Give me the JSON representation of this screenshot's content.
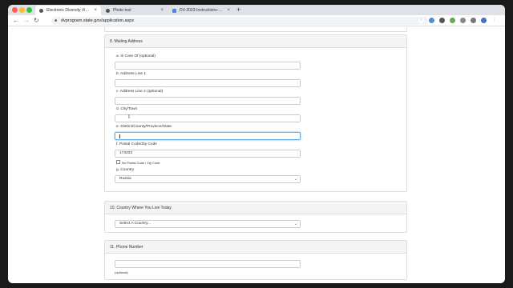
{
  "browser": {
    "tabs": [
      {
        "title": "Electronic Diversity Visa Progr",
        "icon": "globe-icon",
        "active": true
      },
      {
        "title": "Photo tool",
        "icon": "globe-icon",
        "active": false
      },
      {
        "title": "DV-2023-Instructions-English-",
        "icon": "document-icon",
        "active": false
      }
    ],
    "new_tab": "+",
    "tab_close": "×",
    "url": "dvprogram.state.gov/application.aspx"
  },
  "sections": {
    "mailing": {
      "title": "8. Mailing Address",
      "in_care_of_label": "a. In Care Of (optional)",
      "in_care_of_value": "",
      "address1_label": "b. Address Line 1",
      "address1_value": "",
      "address2_label": "c. Address Line 2 (optional)",
      "address2_value": "",
      "city_label": "d. City/Town",
      "city_value": "",
      "district_label": "e. District/County/Province/State",
      "district_value": "",
      "postal_label": "f. Postal Code/Zip Code",
      "postal_value": "173203",
      "no_postal_label": "No Postal Code / Zip Code",
      "country_label": "g. Country",
      "country_value": "Russia"
    },
    "country_live": {
      "title": "10. Country Where You Live Today",
      "select_value": "Select A Country..."
    },
    "phone": {
      "title": "11. Phone Number",
      "value": "",
      "optional_note": "(optional)"
    }
  },
  "colors": {
    "focus_border": "#66afe9",
    "panel_header": "#f5f5f5",
    "tabstrip": "#dee1e6"
  }
}
